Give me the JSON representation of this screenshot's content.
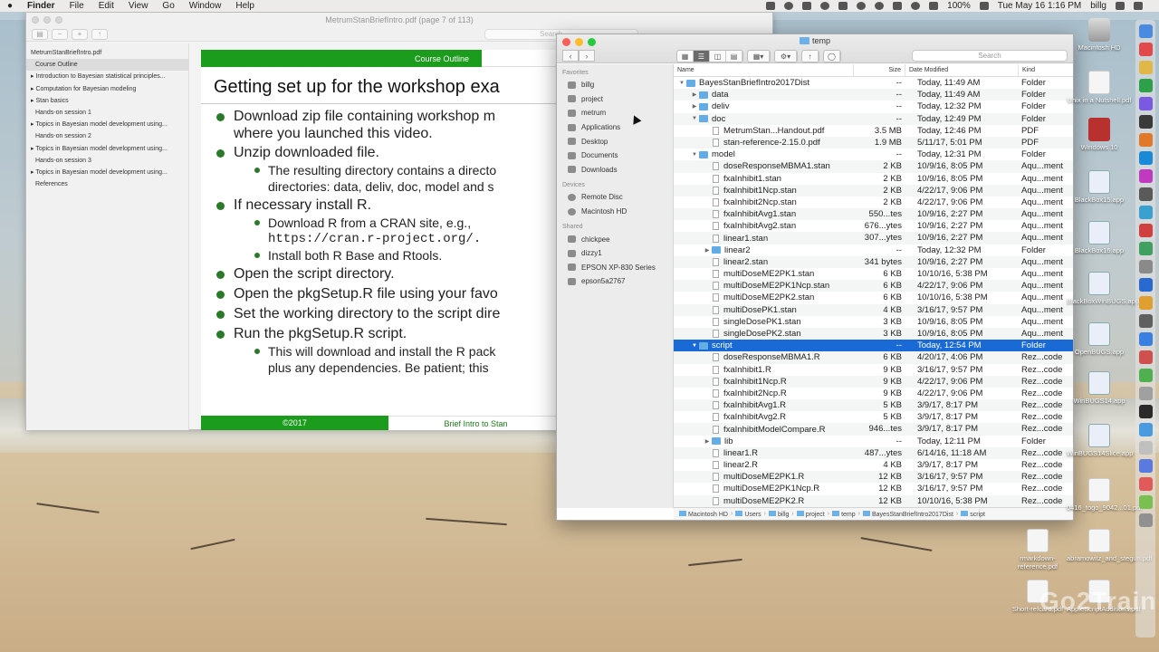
{
  "menubar": {
    "app": "Finder",
    "items": [
      "File",
      "Edit",
      "View",
      "Go",
      "Window",
      "Help"
    ],
    "battery": "100%",
    "clock": "Tue May 16  1:16 PM",
    "user": "billg"
  },
  "preview": {
    "title": "MetrumStanBriefIntro.pdf (page 7 of 113)",
    "search_placeholder": "Search",
    "outline": [
      {
        "label": "MetrumStanBriefIntro.pdf",
        "indent": false,
        "selected": false
      },
      {
        "label": "Course Outline",
        "indent": true,
        "selected": true
      },
      {
        "label": "▸ Introduction to Bayesian statistical principles...",
        "indent": false,
        "selected": false
      },
      {
        "label": "▸ Computation for Bayesian modeling",
        "indent": false,
        "selected": false
      },
      {
        "label": "▸ Stan basics",
        "indent": false,
        "selected": false
      },
      {
        "label": "Hands-on session 1",
        "indent": true,
        "selected": false
      },
      {
        "label": "▸ Topics in Bayesian model development using...",
        "indent": false,
        "selected": false
      },
      {
        "label": "Hands-on session 2",
        "indent": true,
        "selected": false
      },
      {
        "label": "▸ Topics in Bayesian model development using...",
        "indent": false,
        "selected": false
      },
      {
        "label": "Hands-on session 3",
        "indent": true,
        "selected": false
      },
      {
        "label": "▸ Topics in Bayesian model development using...",
        "indent": false,
        "selected": false
      },
      {
        "label": "References",
        "indent": true,
        "selected": false
      }
    ],
    "slide": {
      "header_tag": "Course Outline",
      "heading": "Getting set up for the workshop exa",
      "bullets": [
        {
          "cls": "l1",
          "text": "Download zip file containing workshop m"
        },
        {
          "cls": "cont",
          "text": "where you launched this video."
        },
        {
          "cls": "l1",
          "text": "Unzip downloaded file."
        },
        {
          "cls": "l2",
          "text": "The resulting directory contains a directo"
        },
        {
          "cls": "cont2",
          "text": "directories: data, deliv, doc, model and s"
        },
        {
          "cls": "l1",
          "text": "If necessary install R."
        },
        {
          "cls": "l2",
          "text": "Download R from a CRAN site, e.g.,"
        },
        {
          "cls": "cont2 mono",
          "text": "https://cran.r-project.org/."
        },
        {
          "cls": "l2",
          "text": "Install both R Base and Rtools."
        },
        {
          "cls": "l1",
          "text": "Open the script directory."
        },
        {
          "cls": "l1",
          "text": "Open the pkgSetup.R file using your favo"
        },
        {
          "cls": "l1",
          "text": "Set the working directory to the script dire"
        },
        {
          "cls": "l1",
          "text": "Run the pkgSetup.R script."
        },
        {
          "cls": "l2",
          "text": "This will download and install the R pack"
        },
        {
          "cls": "cont2",
          "text": "plus any dependencies. Be patient; this"
        }
      ],
      "footer_year": "©2017",
      "footer_title": "Brief Intro to Stan"
    }
  },
  "finder": {
    "title": "temp",
    "search_placeholder": "Search",
    "sidebar": {
      "favorites_label": "Favorites",
      "favorites": [
        "billg",
        "project",
        "metrum",
        "Applications",
        "Desktop",
        "Documents",
        "Downloads"
      ],
      "devices_label": "Devices",
      "devices": [
        "Remote Disc",
        "Macintosh HD"
      ],
      "shared_label": "Shared",
      "shared": [
        "chickpee",
        "dizzy1",
        "EPSON XP-830 Series",
        "epson5a2767"
      ]
    },
    "columns": {
      "name": "Name",
      "size": "Size",
      "date": "Date Modified",
      "kind": "Kind"
    },
    "rows": [
      {
        "level": 0,
        "tri": "▼",
        "type": "folder",
        "name": "BayesStanBriefIntro2017Dist",
        "size": "--",
        "date": "Today, 11:49 AM",
        "kind": "Folder",
        "sel": false
      },
      {
        "level": 1,
        "tri": "▶",
        "type": "folder",
        "name": "data",
        "size": "--",
        "date": "Today, 11:49 AM",
        "kind": "Folder",
        "sel": false
      },
      {
        "level": 1,
        "tri": "▶",
        "type": "folder",
        "name": "deliv",
        "size": "--",
        "date": "Today, 12:32 PM",
        "kind": "Folder",
        "sel": false
      },
      {
        "level": 1,
        "tri": "▼",
        "type": "folder",
        "name": "doc",
        "size": "--",
        "date": "Today, 12:49 PM",
        "kind": "Folder",
        "sel": false
      },
      {
        "level": 2,
        "tri": "",
        "type": "file",
        "name": "MetrumStan...Handout.pdf",
        "size": "3.5 MB",
        "date": "Today, 12:46 PM",
        "kind": "PDF",
        "sel": false
      },
      {
        "level": 2,
        "tri": "",
        "type": "file",
        "name": "stan-reference-2.15.0.pdf",
        "size": "1.9 MB",
        "date": "5/11/17, 5:01 PM",
        "kind": "PDF",
        "sel": false
      },
      {
        "level": 1,
        "tri": "▼",
        "type": "folder",
        "name": "model",
        "size": "--",
        "date": "Today, 12:31 PM",
        "kind": "Folder",
        "sel": false
      },
      {
        "level": 2,
        "tri": "",
        "type": "file",
        "name": "doseResponseMBMA1.stan",
        "size": "2 KB",
        "date": "10/9/16, 8:05 PM",
        "kind": "Aqu...ment",
        "sel": false
      },
      {
        "level": 2,
        "tri": "",
        "type": "file",
        "name": "fxaInhibit1.stan",
        "size": "2 KB",
        "date": "10/9/16, 8:05 PM",
        "kind": "Aqu...ment",
        "sel": false
      },
      {
        "level": 2,
        "tri": "",
        "type": "file",
        "name": "fxaInhibit1Ncp.stan",
        "size": "2 KB",
        "date": "4/22/17, 9:06 PM",
        "kind": "Aqu...ment",
        "sel": false
      },
      {
        "level": 2,
        "tri": "",
        "type": "file",
        "name": "fxaInhibit2Ncp.stan",
        "size": "2 KB",
        "date": "4/22/17, 9:06 PM",
        "kind": "Aqu...ment",
        "sel": false
      },
      {
        "level": 2,
        "tri": "",
        "type": "file",
        "name": "fxaInhibitAvg1.stan",
        "size": "550...tes",
        "date": "10/9/16, 2:27 PM",
        "kind": "Aqu...ment",
        "sel": false
      },
      {
        "level": 2,
        "tri": "",
        "type": "file",
        "name": "fxaInhibitAvg2.stan",
        "size": "676...ytes",
        "date": "10/9/16, 2:27 PM",
        "kind": "Aqu...ment",
        "sel": false
      },
      {
        "level": 2,
        "tri": "",
        "type": "file",
        "name": "linear1.stan",
        "size": "307...ytes",
        "date": "10/9/16, 2:27 PM",
        "kind": "Aqu...ment",
        "sel": false
      },
      {
        "level": 2,
        "tri": "▶",
        "type": "folder",
        "name": "linear2",
        "size": "--",
        "date": "Today, 12:32 PM",
        "kind": "Folder",
        "sel": false
      },
      {
        "level": 2,
        "tri": "",
        "type": "file",
        "name": "linear2.stan",
        "size": "341 bytes",
        "date": "10/9/16, 2:27 PM",
        "kind": "Aqu...ment",
        "sel": false
      },
      {
        "level": 2,
        "tri": "",
        "type": "file",
        "name": "multiDoseME2PK1.stan",
        "size": "6 KB",
        "date": "10/10/16, 5:38 PM",
        "kind": "Aqu...ment",
        "sel": false
      },
      {
        "level": 2,
        "tri": "",
        "type": "file",
        "name": "multiDoseME2PK1Ncp.stan",
        "size": "6 KB",
        "date": "4/22/17, 9:06 PM",
        "kind": "Aqu...ment",
        "sel": false
      },
      {
        "level": 2,
        "tri": "",
        "type": "file",
        "name": "multiDoseME2PK2.stan",
        "size": "6 KB",
        "date": "10/10/16, 5:38 PM",
        "kind": "Aqu...ment",
        "sel": false
      },
      {
        "level": 2,
        "tri": "",
        "type": "file",
        "name": "multiDosePK1.stan",
        "size": "4 KB",
        "date": "3/16/17, 9:57 PM",
        "kind": "Aqu...ment",
        "sel": false
      },
      {
        "level": 2,
        "tri": "",
        "type": "file",
        "name": "singleDosePK1.stan",
        "size": "3 KB",
        "date": "10/9/16, 8:05 PM",
        "kind": "Aqu...ment",
        "sel": false
      },
      {
        "level": 2,
        "tri": "",
        "type": "file",
        "name": "singleDosePK2.stan",
        "size": "3 KB",
        "date": "10/9/16, 8:05 PM",
        "kind": "Aqu...ment",
        "sel": false
      },
      {
        "level": 1,
        "tri": "▼",
        "type": "folder",
        "name": "script",
        "size": "--",
        "date": "Today, 12:54 PM",
        "kind": "Folder",
        "sel": true
      },
      {
        "level": 2,
        "tri": "",
        "type": "file",
        "name": "doseResponseMBMA1.R",
        "size": "6 KB",
        "date": "4/20/17, 4:06 PM",
        "kind": "Rez...code",
        "sel": false
      },
      {
        "level": 2,
        "tri": "",
        "type": "file",
        "name": "fxaInhibit1.R",
        "size": "9 KB",
        "date": "3/16/17, 9:57 PM",
        "kind": "Rez...code",
        "sel": false
      },
      {
        "level": 2,
        "tri": "",
        "type": "file",
        "name": "fxaInhibit1Ncp.R",
        "size": "9 KB",
        "date": "4/22/17, 9:06 PM",
        "kind": "Rez...code",
        "sel": false
      },
      {
        "level": 2,
        "tri": "",
        "type": "file",
        "name": "fxaInhibit2Ncp.R",
        "size": "9 KB",
        "date": "4/22/17, 9:06 PM",
        "kind": "Rez...code",
        "sel": false
      },
      {
        "level": 2,
        "tri": "",
        "type": "file",
        "name": "fxaInhibitAvg1.R",
        "size": "5 KB",
        "date": "3/9/17, 8:17 PM",
        "kind": "Rez...code",
        "sel": false
      },
      {
        "level": 2,
        "tri": "",
        "type": "file",
        "name": "fxaInhibitAvg2.R",
        "size": "5 KB",
        "date": "3/9/17, 8:17 PM",
        "kind": "Rez...code",
        "sel": false
      },
      {
        "level": 2,
        "tri": "",
        "type": "file",
        "name": "fxaInhibitModelCompare.R",
        "size": "946...tes",
        "date": "3/9/17, 8:17 PM",
        "kind": "Rez...code",
        "sel": false
      },
      {
        "level": 2,
        "tri": "▶",
        "type": "folder",
        "name": "lib",
        "size": "--",
        "date": "Today, 12:11 PM",
        "kind": "Folder",
        "sel": false
      },
      {
        "level": 2,
        "tri": "",
        "type": "file",
        "name": "linear1.R",
        "size": "487...ytes",
        "date": "6/14/16, 11:18 AM",
        "kind": "Rez...code",
        "sel": false
      },
      {
        "level": 2,
        "tri": "",
        "type": "file",
        "name": "linear2.R",
        "size": "4 KB",
        "date": "3/9/17, 8:17 PM",
        "kind": "Rez...code",
        "sel": false
      },
      {
        "level": 2,
        "tri": "",
        "type": "file",
        "name": "multiDoseME2PK1.R",
        "size": "12 KB",
        "date": "3/16/17, 9:57 PM",
        "kind": "Rez...code",
        "sel": false
      },
      {
        "level": 2,
        "tri": "",
        "type": "file",
        "name": "multiDoseME2PK1Ncp.R",
        "size": "12 KB",
        "date": "3/16/17, 9:57 PM",
        "kind": "Rez...code",
        "sel": false
      },
      {
        "level": 2,
        "tri": "",
        "type": "file",
        "name": "multiDoseME2PK2.R",
        "size": "12 KB",
        "date": "10/10/16, 5:38 PM",
        "kind": "Rez...code",
        "sel": false
      }
    ],
    "path": [
      "Macintosh HD",
      "Users",
      "billg",
      "project",
      "temp",
      "BayesStanBriefIntro2017Dist",
      "script"
    ]
  },
  "desktop_icons": [
    {
      "label": "Macintosh HD",
      "kind": "hd"
    },
    {
      "label": "Unix in a Nutshell.pdf",
      "kind": "doc"
    },
    {
      "label": "Windows 10",
      "kind": "red"
    },
    {
      "label": "BlackBox15.app",
      "kind": "bugs"
    },
    {
      "label": "BlackBox16.app",
      "kind": "bugs"
    },
    {
      "label": "BlackBoxWinBUGS.app",
      "kind": "bugs"
    },
    {
      "label": "OpenBUGS.app",
      "kind": "bugs"
    },
    {
      "label": "WinBUGS14.app",
      "kind": "bugs"
    },
    {
      "label": "WinBUGS14Slice.app",
      "kind": "bugs"
    },
    {
      "label": "0416_togo_9042...01.pdf",
      "kind": "doc"
    },
    {
      "label": "rmarkdown-reference.pdf",
      "kind": "doc"
    },
    {
      "label": "abramowitz_and_stegun.pdf",
      "kind": "doc"
    },
    {
      "label": "Short-refcard.pdf",
      "kind": "doc"
    },
    {
      "label": "AppleScriptAdditions.pdf",
      "kind": "doc"
    }
  ],
  "colors": {
    "finder_selection": "#1a6ad6",
    "slide_green": "#1c9c1c",
    "folder_blue": "#63ace4"
  },
  "watermark": "Go2Train"
}
